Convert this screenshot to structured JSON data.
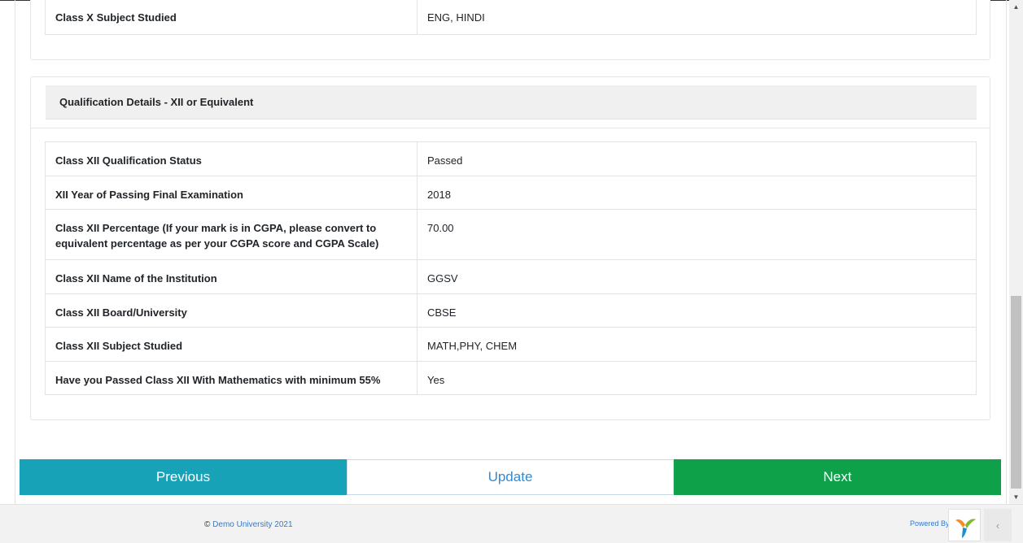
{
  "class_x": {
    "rows": [
      {
        "label": "Class X Subject Studied",
        "value": "ENG, HINDI"
      }
    ]
  },
  "class_xii": {
    "title": "Qualification Details - XII or Equivalent",
    "rows": [
      {
        "label": "Class XII Qualification Status",
        "value": "Passed"
      },
      {
        "label": "XII Year of Passing Final Examination",
        "value": "2018"
      },
      {
        "label": "Class XII Percentage (If your mark is in CGPA, please convert to equivalent percentage as per your CGPA score and CGPA Scale)",
        "value": "70.00"
      },
      {
        "label": "Class XII Name of the Institution",
        "value": "GGSV"
      },
      {
        "label": "Class XII Board/University",
        "value": "CBSE"
      },
      {
        "label": "Class XII Subject Studied",
        "value": "MATH,PHY, CHEM"
      },
      {
        "label": "Have you Passed Class XII With Mathematics with minimum 55%",
        "value": "Yes"
      }
    ]
  },
  "buttons": {
    "previous": "Previous",
    "update": "Update",
    "next": "Next"
  },
  "footer": {
    "copyright_symbol": "©",
    "copyright_link": "Demo University 2021",
    "powered_by": "Powered By:",
    "collapse_glyph": "‹"
  },
  "colors": {
    "previous": "#17a2b8",
    "next": "#0ea149",
    "update_text": "#2e8bd6",
    "link": "#2f7bd5"
  },
  "icons": {
    "logo": "powered-by-logo-icon",
    "collapse": "chevron-left-icon"
  }
}
